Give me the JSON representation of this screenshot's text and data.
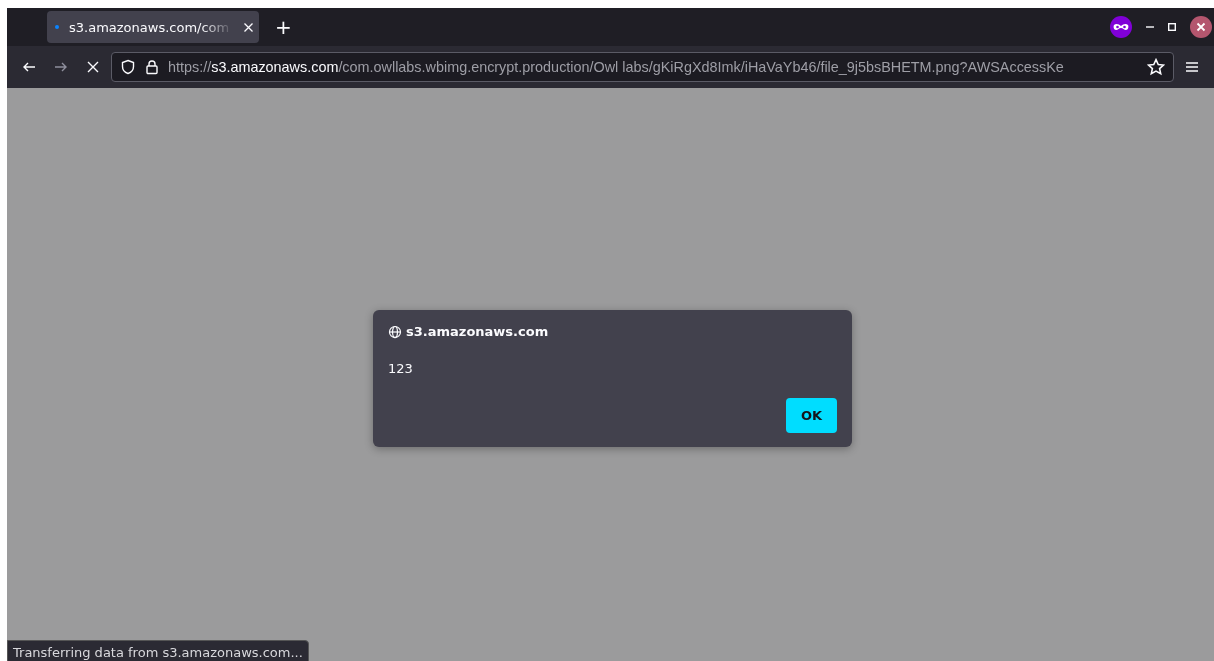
{
  "tabs": [
    {
      "title": "s3.amazonaws.com/com",
      "selected": true,
      "loading": true
    }
  ],
  "new_tab": "+",
  "address_bar": {
    "scheme": "https://",
    "host": "s3.amazonaws.com",
    "path": "/com.owllabs.wbimg.encrypt.production/Owl labs/gKiRgXd8Imk/iHaVaYb46/file_9j5bsBHETM.png?AWSAccessKe"
  },
  "dialog": {
    "origin": "s3.amazonaws.com",
    "message": "123",
    "buttons": [
      "OK"
    ]
  },
  "status_bar": "Transferring data from s3.amazonaws.com..."
}
